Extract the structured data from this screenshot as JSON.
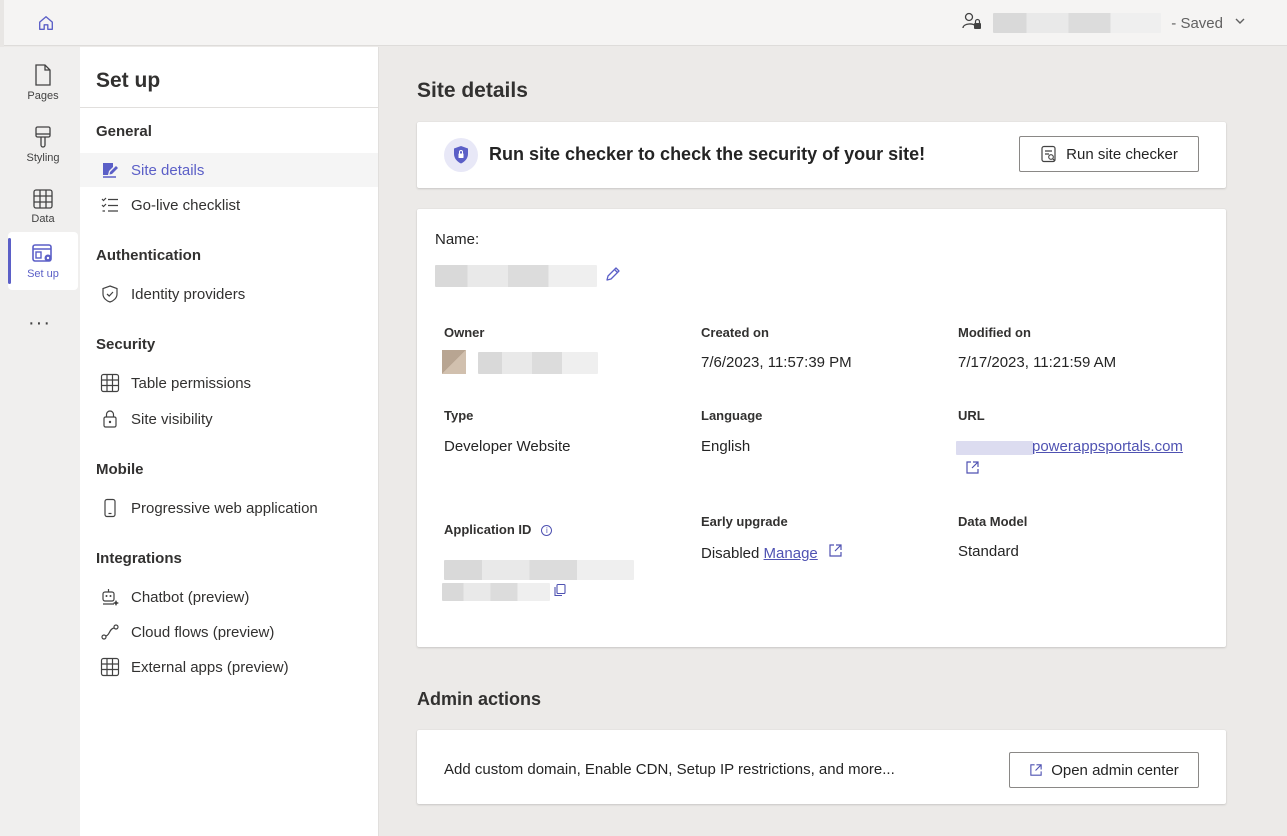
{
  "topbar": {
    "home_icon": "home-icon",
    "user_icon": "user-lock-icon",
    "saved_text": "- Saved",
    "chevron_icon": "chevron-down-icon"
  },
  "rail": {
    "items": [
      {
        "label": "Pages",
        "icon": "page-icon"
      },
      {
        "label": "Styling",
        "icon": "brush-icon"
      },
      {
        "label": "Data",
        "icon": "table-icon"
      },
      {
        "label": "Set up",
        "icon": "setup-icon",
        "active": true
      }
    ],
    "more": "···"
  },
  "setup": {
    "title": "Set up",
    "sections": [
      {
        "heading": "General",
        "items": [
          {
            "label": "Site details",
            "icon": "edit-page-icon",
            "active": true
          },
          {
            "label": "Go-live checklist",
            "icon": "checklist-icon"
          }
        ]
      },
      {
        "heading": "Authentication",
        "items": [
          {
            "label": "Identity providers",
            "icon": "shield-check-icon"
          }
        ]
      },
      {
        "heading": "Security",
        "items": [
          {
            "label": "Table permissions",
            "icon": "table-icon"
          },
          {
            "label": "Site visibility",
            "icon": "lock-icon"
          }
        ]
      },
      {
        "heading": "Mobile",
        "items": [
          {
            "label": "Progressive web application",
            "icon": "phone-icon"
          }
        ]
      },
      {
        "heading": "Integrations",
        "items": [
          {
            "label": "Chatbot (preview)",
            "icon": "bot-icon"
          },
          {
            "label": "Cloud flows (preview)",
            "icon": "flow-icon"
          },
          {
            "label": "External apps (preview)",
            "icon": "table-icon"
          }
        ]
      }
    ]
  },
  "main": {
    "title": "Site details",
    "checker": {
      "text": "Run site checker to check the security of your site!",
      "button": "Run site checker"
    },
    "details": {
      "name_label": "Name:",
      "owner_label": "Owner",
      "created_label": "Created on",
      "created_value": "7/6/2023, 11:57:39 PM",
      "modified_label": "Modified on",
      "modified_value": "7/17/2023, 11:21:59 AM",
      "type_label": "Type",
      "type_value": "Developer Website",
      "language_label": "Language",
      "language_value": "English",
      "url_label": "URL",
      "url_value": "powerappsportals.com",
      "appid_label": "Application ID",
      "early_label": "Early upgrade",
      "early_value": "Disabled",
      "early_link": "Manage",
      "datamodel_label": "Data Model",
      "datamodel_value": "Standard"
    },
    "admin": {
      "title": "Admin actions",
      "text": "Add custom domain, Enable CDN, Setup IP restrictions, and more...",
      "button": "Open admin center"
    }
  }
}
